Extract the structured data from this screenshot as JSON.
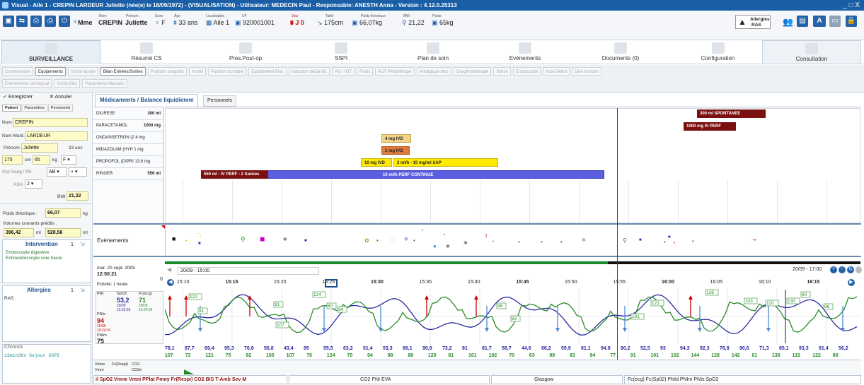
{
  "window": {
    "title": "Visual - Aile 1 - CREPIN LARDEUR Juliette (née(e) le 18/09/1972) - (VISUALISATION) - Utilisateur: MEDECIN Paul - Responsable: ANESTH Anna - Version : 4.12.0.25313",
    "controls": "_ □ X"
  },
  "patient_header": {
    "civility": "Mme",
    "nom_label": "Nom",
    "nom": "CREPIN",
    "prenom_label": "Prénom",
    "prenom": "Juliette",
    "sexe_label": "Sexe",
    "sexe": "F",
    "age_label": "Âge",
    "age": "33 ans",
    "localisation_label": "Localisation",
    "localisation": "Aile 1",
    "uf_label": "UF",
    "uf": "920001001",
    "jour_label": "Jour",
    "jour": "J 0",
    "taille_label": "Taille",
    "taille": "175cm",
    "poids_theo_label": "Poids théorique",
    "poids_theo": "66,07kg",
    "bmi_label": "BMI",
    "bmi": "21,22",
    "poids_label": "Poids",
    "poids": "65kg",
    "allergies_label": "Allergies",
    "allergies_value": "RAS"
  },
  "tabs": [
    {
      "label": "SURVEILLANCE",
      "active": true
    },
    {
      "label": "Résumé CS"
    },
    {
      "label": "Pres.Post-op"
    },
    {
      "label": "SSPI"
    },
    {
      "label": "Plan de soin"
    },
    {
      "label": "Evénements"
    },
    {
      "label": "Documents (0)"
    },
    {
      "label": "Configuration"
    },
    {
      "label": "Consultation"
    }
  ],
  "toolbar_row1": [
    "Commentaire",
    "Equipements",
    "Sortie liquide",
    "Bilan Entrées/Sorties",
    "Produits sanguins",
    "Install",
    "Position sur table",
    "Equipement Bloc",
    "Induction pédia ML",
    "AG / IOT",
    "Rachi",
    "ALR Périphérique",
    "Antalgique bloc",
    "Oxygénothérapie",
    "Sismo",
    "Endoscopie",
    "Acte Début",
    "1ère incision"
  ],
  "toolbar_row2": [
    "Evenements chirurgical",
    "Sortie Bloc",
    "Paramètres Manuels"
  ],
  "left_panel": {
    "save": "Enregistrer",
    "cancel": "Annuler",
    "subtabs": [
      "Patient",
      "Paramètres",
      "Personnels"
    ],
    "nom_label": "Nom",
    "nom": "CREPIN",
    "nom_marit_label": "Nom Marit.",
    "nom_marit": "LARDEUR",
    "prenom_label": "Prénom",
    "prenom": "Juliette",
    "age": "33 ans",
    "taille": "175",
    "taille_unit": "cm",
    "poids": "65",
    "poids_unit": "kg",
    "sexe": "F",
    "grp_sang_label": "Grp Sang / Rh",
    "grp_sang": "AB",
    "rh": "+",
    "asa_label": "ASA",
    "asa": "2",
    "bmi_label": "BMI",
    "bmi": "21,22",
    "poids_theo_label": "Poids théorique :",
    "poids_theo": "66,07",
    "poids_theo_unit": "kg",
    "volumes_label": "Volumes courants prédits :",
    "vol1": "396,42",
    "vol1_unit": "ml",
    "vol2": "528,56",
    "vol2_unit": "ml",
    "intervention_title": "Intervention",
    "intervention_count": "1",
    "interventions": [
      "Endoscopie digestive",
      "Echoendoscopie voie haute"
    ],
    "allergies_title": "Allergies",
    "allergies_count": "1",
    "allergies": "RAS",
    "chronos_title": "Chronos",
    "chronos_value": "13min36s Sejour SSPI"
  },
  "main_tabs": [
    "Médicaments / Balance liquidienne",
    "Personnels"
  ],
  "med_rows": [
    {
      "name": "DIURESE",
      "qty": "300 ml"
    },
    {
      "name": "PARACETAMOL",
      "qty": "1000 mg"
    },
    {
      "name": "ONDANSETRON (2 4 mg",
      "qty": ""
    },
    {
      "name": "MIDAZOLAM (HYP 1 mg",
      "qty": ""
    },
    {
      "name": "PROPOFOL (DIPRI 13,6 mg",
      "qty": ""
    },
    {
      "name": "RINGER",
      "qty": "556 ml"
    }
  ],
  "med_bars": {
    "diurese": "300 ml  SPONTANEE",
    "paracetamol": "1000 mg  IV PERF",
    "ondansetron": "4 mg  IVD",
    "midazolam": "1 mg  IVD",
    "propofol_bolus": "10 mg  IVD",
    "propofol_perf": "2 ml/h - 10 mg/ml  SAP",
    "ringer_bolus": "550 ml - IV PERF - 2 Saisies",
    "ringer_perf": "10 ml/h  PERF CONTINUE"
  },
  "events_label": "Evènements",
  "timeline": {
    "date": "mar. 20 sept. 2005",
    "time": "12:50:21",
    "zero": "0",
    "scale": "Echelle: 1 heure",
    "range_start": "20/09 - 15:00",
    "range_end": "20/09 - 17:00",
    "ticks": [
      "15:10",
      "15:15",
      "15:20",
      "15:25",
      "15:30",
      "15:35",
      "15:40",
      "15:45",
      "15:50",
      "15:55",
      "16:00",
      "16:05",
      "16:10",
      "16:15"
    ]
  },
  "vitals_legend": {
    "pni": "PNI",
    "spo2_label": "SpO2",
    "spo2": "53,2",
    "spo2_time": "20/09 16:23:55",
    "fc_label": "Fc(ecg)",
    "fc": "71",
    "fc_time": "20/09 16:24:05",
    "pnis_label": "PNIs",
    "pnis": "94",
    "pnis_time": "20/09 16:24:01",
    "pnim_label": "PNIm",
    "pnim": "75"
  },
  "graph_labels": [
    "121",
    "107",
    "81",
    "91",
    "124",
    "94",
    "60",
    "96",
    "63",
    "101",
    "121",
    "128",
    "103",
    "110",
    "130",
    "60",
    "86"
  ],
  "values_row1": [
    "78,1",
    "87,7",
    "69,4",
    "95,3",
    "70,8",
    "56,8",
    "43,4",
    "95",
    "55,5",
    "63,2",
    "51,4",
    "53,3",
    "89,1",
    "90,9",
    "73,2",
    "81",
    "81,7",
    "58,7",
    "44,6",
    "66,2",
    "59,9",
    "81,1",
    "94,8",
    "80,2",
    "52,5",
    "93",
    "94,3",
    "92,3",
    "76,8",
    "90,6",
    "71,3",
    "85,1",
    "93,3",
    "91,4",
    "56,2"
  ],
  "values_row2": [
    "107",
    "73",
    "121",
    "75",
    "92",
    "105",
    "107",
    "76",
    "124",
    "70",
    "94",
    "98",
    "88",
    "120",
    "81",
    "101",
    "102",
    "70",
    "63",
    "99",
    "83",
    "94",
    "77",
    "91",
    "101",
    "102",
    "144",
    "128",
    "142",
    "61",
    "136",
    "115",
    "122",
    "86"
  ],
  "bottom_legend": {
    "col1": [
      "Vmne",
      "Fr(Respi)",
      "CO2",
      "Vmni",
      "CO2e"
    ],
    "params": "il SpO2  Vmne Vmni PPlat Pmoy Fr(Respi) CO2  BIS T-Amb Sev M",
    "group2": "CO2  PNI  EVA",
    "group3": "Glasgow",
    "group4": "Fc(ecg) Fc(Sp02) PNId PNIm PNIs SpO2"
  }
}
